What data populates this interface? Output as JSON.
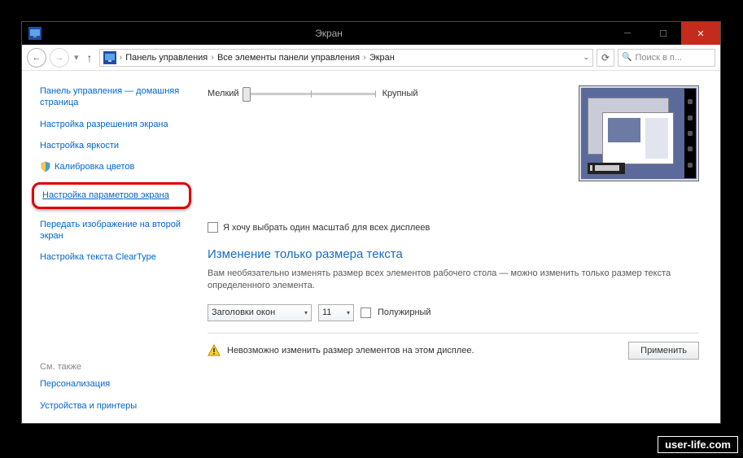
{
  "titlebar": {
    "title": "Экран"
  },
  "breadcrumb": {
    "items": [
      "Панель управления",
      "Все элементы панели управления",
      "Экран"
    ]
  },
  "navbar": {
    "search_placeholder": "Поиск в п..."
  },
  "sidebar": {
    "home": "Панель управления — домашняя страница",
    "resolution": "Настройка разрешения экрана",
    "brightness": "Настройка яркости",
    "calibration": "Калибровка цветов",
    "params": "Настройка параметров экрана",
    "second_screen": "Передать изображение на второй экран",
    "cleartype": "Настройка текста ClearType",
    "see_also": "См. также",
    "personalization": "Персонализация",
    "devices": "Устройства и принтеры"
  },
  "content": {
    "small": "Мелкий",
    "large": "Крупный",
    "checkbox_label": "Я хочу выбрать один масштаб для всех дисплеев",
    "section_title": "Изменение только размера текста",
    "section_desc": "Вам необязательно изменять размер всех элементов рабочего стола — можно изменить только размер текста определенного элемента.",
    "element_select": "Заголовки окон",
    "size_select": "11",
    "bold_label": "Полужирный",
    "warning": "Невозможно изменить размер элементов на этом дисплее.",
    "apply": "Применить"
  },
  "watermark": "user-life.com",
  "colors": {
    "accent": "#0066cc",
    "heading": "#1a6bbf",
    "highlight_border": "#d00"
  }
}
